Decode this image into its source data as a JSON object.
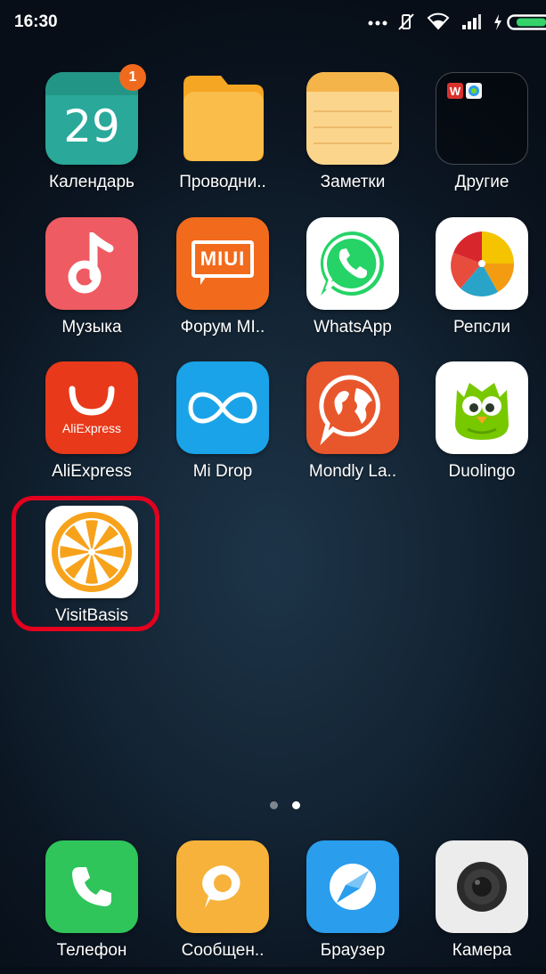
{
  "status_bar": {
    "time": "16:30",
    "icons": [
      "more-dots-icon",
      "vibrate-off-icon",
      "wifi-icon",
      "signal-icon",
      "charging-icon",
      "battery-icon"
    ]
  },
  "apps": {
    "calendar": {
      "label": "Календарь",
      "date": "29",
      "badge": "1"
    },
    "explorer": {
      "label": "Проводни.."
    },
    "notes": {
      "label": "Заметки"
    },
    "others": {
      "label": "Другие"
    },
    "music": {
      "label": "Музыка"
    },
    "miui_forum": {
      "label": "Форум MI..",
      "logo_text": "MIUI"
    },
    "whatsapp": {
      "label": "WhatsApp"
    },
    "repsli": {
      "label": "Репсли"
    },
    "aliexpress": {
      "label": "AliExpress",
      "logo_text": "AliExpress"
    },
    "mi_drop": {
      "label": "Mi Drop"
    },
    "mondly": {
      "label": "Mondly La.."
    },
    "duolingo": {
      "label": "Duolingo"
    },
    "visitbasis": {
      "label": "VisitBasis"
    }
  },
  "page_indicator": {
    "pages": 2,
    "current": 2
  },
  "dock": {
    "phone": {
      "label": "Телефон"
    },
    "messages": {
      "label": "Сообщен.."
    },
    "browser": {
      "label": "Браузер"
    },
    "camera": {
      "label": "Камера"
    }
  },
  "colors": {
    "highlight": "#e4001e",
    "badge": "#f06a1e",
    "calendar": "#2aa89a",
    "folder": "#f7b23b",
    "music": "#ef5b62",
    "miui": "#f26b1d",
    "whatsapp": "#25d366",
    "aliexpress": "#e8391a",
    "mi_drop": "#1aa3e8",
    "mondly": "#e8562c",
    "duolingo": "#78c800",
    "visitbasis": "#f7a21b",
    "phone": "#2fc55b",
    "messages": "#f7b23b",
    "browser": "#2a9ded"
  }
}
